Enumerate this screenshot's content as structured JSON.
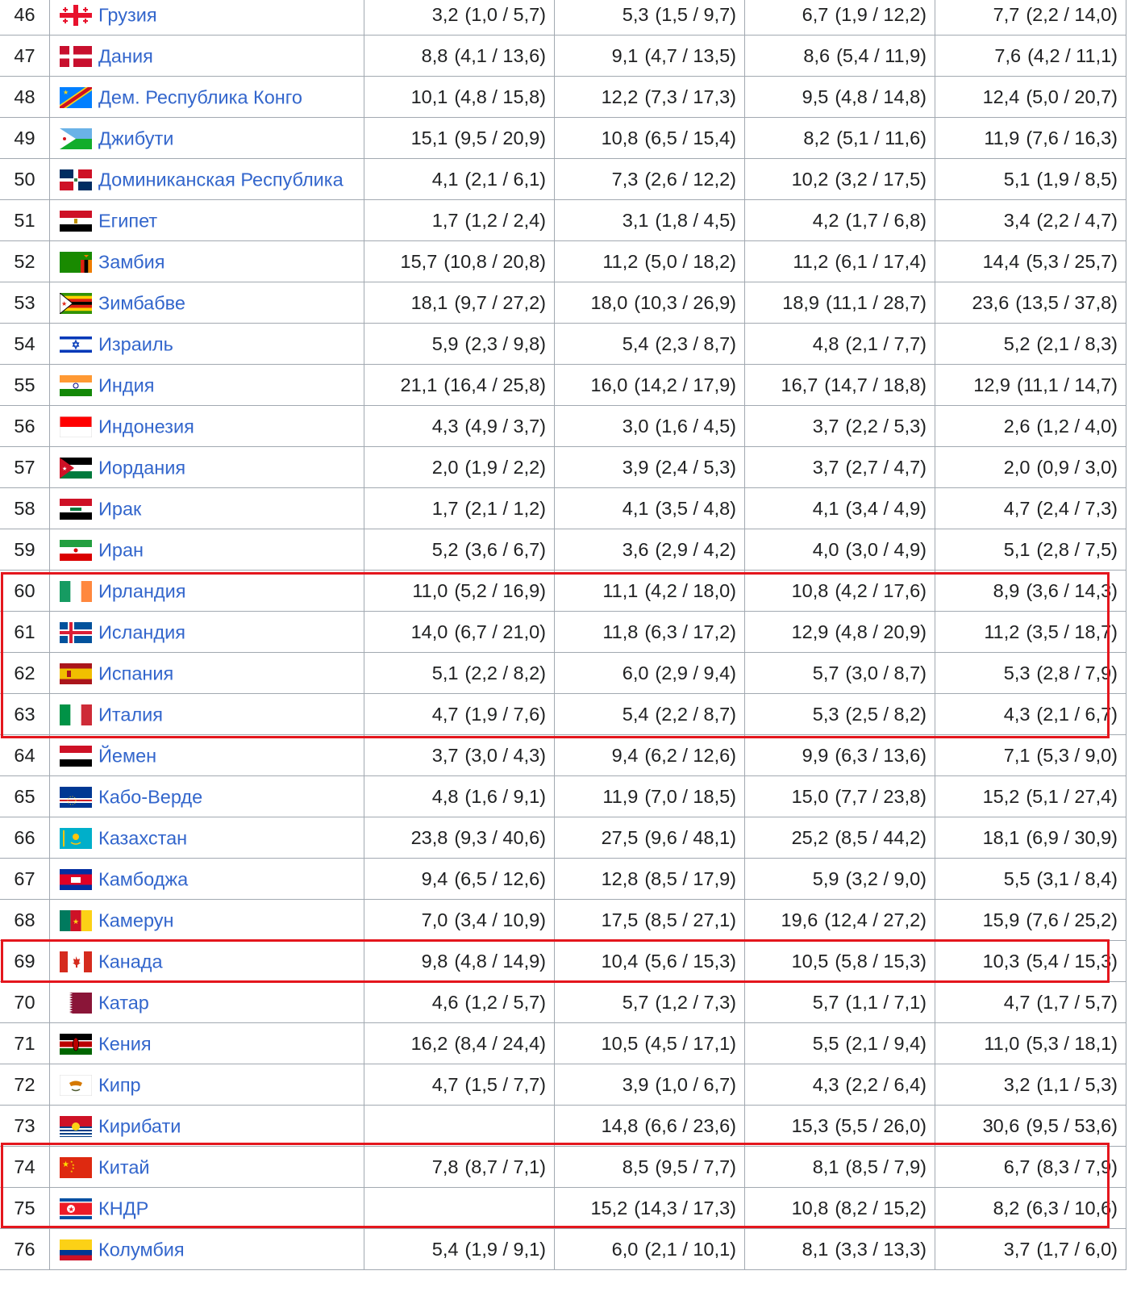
{
  "rows": [
    {
      "n": "46",
      "country": "Грузия",
      "flag": "georgia",
      "v": [
        [
          "3,2",
          "(1,0 / 5,7)"
        ],
        [
          "5,3",
          "(1,5 / 9,7)"
        ],
        [
          "6,7",
          "(1,9 / 12,2)"
        ],
        [
          "7,7",
          "(2,2 / 14,0)"
        ]
      ]
    },
    {
      "n": "47",
      "country": "Дания",
      "flag": "denmark",
      "v": [
        [
          "8,8",
          "(4,1 / 13,6)"
        ],
        [
          "9,1",
          "(4,7 / 13,5)"
        ],
        [
          "8,6",
          "(5,4 / 11,9)"
        ],
        [
          "7,6",
          "(4,2 / 11,1)"
        ]
      ]
    },
    {
      "n": "48",
      "country": "Дем. Республика Конго",
      "flag": "drc",
      "v": [
        [
          "10,1",
          "(4,8 / 15,8)"
        ],
        [
          "12,2",
          "(7,3 / 17,3)"
        ],
        [
          "9,5",
          "(4,8 / 14,8)"
        ],
        [
          "12,4",
          "(5,0 / 20,7)"
        ]
      ]
    },
    {
      "n": "49",
      "country": "Джибути",
      "flag": "djibouti",
      "v": [
        [
          "15,1",
          "(9,5 / 20,9)"
        ],
        [
          "10,8",
          "(6,5 / 15,4)"
        ],
        [
          "8,2",
          "(5,1 / 11,6)"
        ],
        [
          "11,9",
          "(7,6 / 16,3)"
        ]
      ]
    },
    {
      "n": "50",
      "country": "Доминиканская Республика",
      "flag": "dominican",
      "v": [
        [
          "4,1",
          "(2,1 / 6,1)"
        ],
        [
          "7,3",
          "(2,6 / 12,2)"
        ],
        [
          "10,2",
          "(3,2 / 17,5)"
        ],
        [
          "5,1",
          "(1,9 / 8,5)"
        ]
      ]
    },
    {
      "n": "51",
      "country": "Египет",
      "flag": "egypt",
      "v": [
        [
          "1,7",
          "(1,2 / 2,4)"
        ],
        [
          "3,1",
          "(1,8 / 4,5)"
        ],
        [
          "4,2",
          "(1,7 / 6,8)"
        ],
        [
          "3,4",
          "(2,2 / 4,7)"
        ]
      ]
    },
    {
      "n": "52",
      "country": "Замбия",
      "flag": "zambia",
      "v": [
        [
          "15,7",
          "(10,8 / 20,8)"
        ],
        [
          "11,2",
          "(5,0 / 18,2)"
        ],
        [
          "11,2",
          "(6,1 / 17,4)"
        ],
        [
          "14,4",
          "(5,3 / 25,7)"
        ]
      ]
    },
    {
      "n": "53",
      "country": "Зимбабве",
      "flag": "zimbabwe",
      "v": [
        [
          "18,1",
          "(9,7 / 27,2)"
        ],
        [
          "18,0",
          "(10,3 / 26,9)"
        ],
        [
          "18,9",
          "(11,1 / 28,7)"
        ],
        [
          "23,6",
          "(13,5 / 37,8)"
        ]
      ]
    },
    {
      "n": "54",
      "country": "Израиль",
      "flag": "israel",
      "v": [
        [
          "5,9",
          "(2,3 / 9,8)"
        ],
        [
          "5,4",
          "(2,3 / 8,7)"
        ],
        [
          "4,8",
          "(2,1 / 7,7)"
        ],
        [
          "5,2",
          "(2,1 / 8,3)"
        ]
      ]
    },
    {
      "n": "55",
      "country": "Индия",
      "flag": "india",
      "v": [
        [
          "21,1",
          "(16,4 / 25,8)"
        ],
        [
          "16,0",
          "(14,2 / 17,9)"
        ],
        [
          "16,7",
          "(14,7 / 18,8)"
        ],
        [
          "12,9",
          "(11,1 / 14,7)"
        ]
      ]
    },
    {
      "n": "56",
      "country": "Индонезия",
      "flag": "indonesia",
      "v": [
        [
          "4,3",
          "(4,9 / 3,7)"
        ],
        [
          "3,0",
          "(1,6 / 4,5)"
        ],
        [
          "3,7",
          "(2,2 / 5,3)"
        ],
        [
          "2,6",
          "(1,2 / 4,0)"
        ]
      ]
    },
    {
      "n": "57",
      "country": "Иордания",
      "flag": "jordan",
      "v": [
        [
          "2,0",
          "(1,9 / 2,2)"
        ],
        [
          "3,9",
          "(2,4 / 5,3)"
        ],
        [
          "3,7",
          "(2,7 / 4,7)"
        ],
        [
          "2,0",
          "(0,9 / 3,0)"
        ]
      ]
    },
    {
      "n": "58",
      "country": "Ирак",
      "flag": "iraq",
      "v": [
        [
          "1,7",
          "(2,1 / 1,2)"
        ],
        [
          "4,1",
          "(3,5 / 4,8)"
        ],
        [
          "4,1",
          "(3,4 / 4,9)"
        ],
        [
          "4,7",
          "(2,4 / 7,3)"
        ]
      ]
    },
    {
      "n": "59",
      "country": "Иран",
      "flag": "iran",
      "v": [
        [
          "5,2",
          "(3,6 / 6,7)"
        ],
        [
          "3,6",
          "(2,9 / 4,2)"
        ],
        [
          "4,0",
          "(3,0 / 4,9)"
        ],
        [
          "5,1",
          "(2,8 / 7,5)"
        ]
      ]
    },
    {
      "n": "60",
      "country": "Ирландия",
      "flag": "ireland",
      "v": [
        [
          "11,0",
          "(5,2 / 16,9)"
        ],
        [
          "11,1",
          "(4,2 / 18,0)"
        ],
        [
          "10,8",
          "(4,2 / 17,6)"
        ],
        [
          "8,9",
          "(3,6 / 14,3)"
        ]
      ]
    },
    {
      "n": "61",
      "country": "Исландия",
      "flag": "iceland",
      "v": [
        [
          "14,0",
          "(6,7 / 21,0)"
        ],
        [
          "11,8",
          "(6,3 / 17,2)"
        ],
        [
          "12,9",
          "(4,8 / 20,9)"
        ],
        [
          "11,2",
          "(3,5 / 18,7)"
        ]
      ]
    },
    {
      "n": "62",
      "country": "Испания",
      "flag": "spain",
      "v": [
        [
          "5,1",
          "(2,2 / 8,2)"
        ],
        [
          "6,0",
          "(2,9 / 9,4)"
        ],
        [
          "5,7",
          "(3,0 / 8,7)"
        ],
        [
          "5,3",
          "(2,8 / 7,9)"
        ]
      ]
    },
    {
      "n": "63",
      "country": "Италия",
      "flag": "italy",
      "v": [
        [
          "4,7",
          "(1,9 / 7,6)"
        ],
        [
          "5,4",
          "(2,2 / 8,7)"
        ],
        [
          "5,3",
          "(2,5 / 8,2)"
        ],
        [
          "4,3",
          "(2,1 / 6,7)"
        ]
      ]
    },
    {
      "n": "64",
      "country": "Йемен",
      "flag": "yemen",
      "v": [
        [
          "3,7",
          "(3,0 / 4,3)"
        ],
        [
          "9,4",
          "(6,2 / 12,6)"
        ],
        [
          "9,9",
          "(6,3 / 13,6)"
        ],
        [
          "7,1",
          "(5,3 / 9,0)"
        ]
      ]
    },
    {
      "n": "65",
      "country": "Кабо-Верде",
      "flag": "capeverde",
      "v": [
        [
          "4,8",
          "(1,6 / 9,1)"
        ],
        [
          "11,9",
          "(7,0 / 18,5)"
        ],
        [
          "15,0",
          "(7,7 / 23,8)"
        ],
        [
          "15,2",
          "(5,1 / 27,4)"
        ]
      ]
    },
    {
      "n": "66",
      "country": "Казахстан",
      "flag": "kazakhstan",
      "v": [
        [
          "23,8",
          "(9,3 / 40,6)"
        ],
        [
          "27,5",
          "(9,6 / 48,1)"
        ],
        [
          "25,2",
          "(8,5 / 44,2)"
        ],
        [
          "18,1",
          "(6,9 / 30,9)"
        ]
      ]
    },
    {
      "n": "67",
      "country": "Камбоджа",
      "flag": "cambodia",
      "v": [
        [
          "9,4",
          "(6,5 / 12,6)"
        ],
        [
          "12,8",
          "(8,5 / 17,9)"
        ],
        [
          "5,9",
          "(3,2 / 9,0)"
        ],
        [
          "5,5",
          "(3,1 / 8,4)"
        ]
      ]
    },
    {
      "n": "68",
      "country": "Камерун",
      "flag": "cameroon",
      "v": [
        [
          "7,0",
          "(3,4 / 10,9)"
        ],
        [
          "17,5",
          "(8,5 / 27,1)"
        ],
        [
          "19,6",
          "(12,4 / 27,2)"
        ],
        [
          "15,9",
          "(7,6 / 25,2)"
        ]
      ]
    },
    {
      "n": "69",
      "country": "Канада",
      "flag": "canada",
      "v": [
        [
          "9,8",
          "(4,8 / 14,9)"
        ],
        [
          "10,4",
          "(5,6 / 15,3)"
        ],
        [
          "10,5",
          "(5,8 / 15,3)"
        ],
        [
          "10,3",
          "(5,4 / 15,3)"
        ]
      ]
    },
    {
      "n": "70",
      "country": "Катар",
      "flag": "qatar",
      "v": [
        [
          "4,6",
          "(1,2 / 5,7)"
        ],
        [
          "5,7",
          "(1,2 / 7,3)"
        ],
        [
          "5,7",
          "(1,1 / 7,1)"
        ],
        [
          "4,7",
          "(1,7 / 5,7)"
        ]
      ]
    },
    {
      "n": "71",
      "country": "Кения",
      "flag": "kenya",
      "v": [
        [
          "16,2",
          "(8,4 / 24,4)"
        ],
        [
          "10,5",
          "(4,5 / 17,1)"
        ],
        [
          "5,5",
          "(2,1 / 9,4)"
        ],
        [
          "11,0",
          "(5,3 / 18,1)"
        ]
      ]
    },
    {
      "n": "72",
      "country": "Кипр",
      "flag": "cyprus",
      "v": [
        [
          "4,7",
          "(1,5 / 7,7)"
        ],
        [
          "3,9",
          "(1,0 / 6,7)"
        ],
        [
          "4,3",
          "(2,2 / 6,4)"
        ],
        [
          "3,2",
          "(1,1 / 5,3)"
        ]
      ]
    },
    {
      "n": "73",
      "country": "Кирибати",
      "flag": "kiribati",
      "v": [
        [
          "",
          ""
        ],
        [
          "14,8",
          "(6,6 / 23,6)"
        ],
        [
          "15,3",
          "(5,5 / 26,0)"
        ],
        [
          "30,6",
          "(9,5 / 53,6)"
        ]
      ]
    },
    {
      "n": "74",
      "country": "Китай",
      "flag": "china",
      "v": [
        [
          "7,8",
          "(8,7 / 7,1)"
        ],
        [
          "8,5",
          "(9,5 / 7,7)"
        ],
        [
          "8,1",
          "(8,5 / 7,9)"
        ],
        [
          "6,7",
          "(8,3 / 7,9)"
        ]
      ]
    },
    {
      "n": "75",
      "country": "КНДР",
      "flag": "northkorea",
      "v": [
        [
          "",
          ""
        ],
        [
          "15,2",
          "(14,3 / 17,3)"
        ],
        [
          "10,8",
          "(8,2 / 15,2)"
        ],
        [
          "8,2",
          "(6,3 / 10,6)"
        ]
      ]
    },
    {
      "n": "76",
      "country": "Колумбия",
      "flag": "colombia",
      "v": [
        [
          "5,4",
          "(1,9 / 9,1)"
        ],
        [
          "6,0",
          "(2,1 / 10,1)"
        ],
        [
          "8,1",
          "(3,3 / 13,3)"
        ],
        [
          "3,7",
          "(1,7 / 6,0)"
        ]
      ]
    }
  ],
  "highlight_color": "#e4161d",
  "link_color": "#3366cc"
}
